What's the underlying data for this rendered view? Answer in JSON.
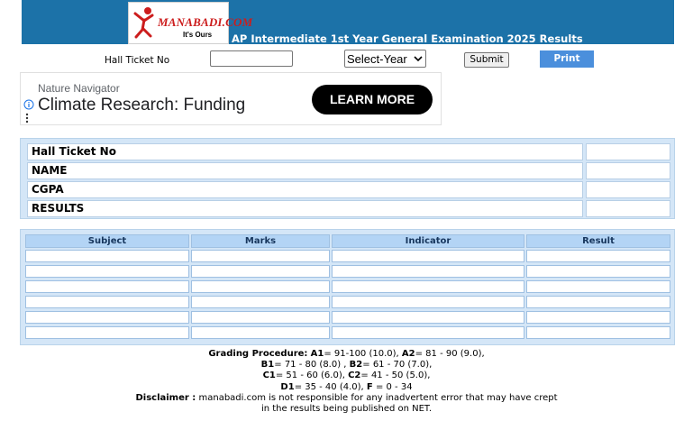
{
  "header": {
    "logo_text": "MANABADI.COM",
    "logo_tagline": "It's Ours",
    "title": "AP Intermediate 1st Year General Examination 2025 Results"
  },
  "form": {
    "hall_ticket_label": "Hall Ticket No",
    "hall_ticket_value": "",
    "year_select_value": "Select-Year",
    "submit_label": "Submit",
    "print_label": "Print"
  },
  "ad": {
    "source": "Nature Navigator",
    "headline": "Climate Research: Funding",
    "cta": "LEARN MORE"
  },
  "info": {
    "rows": [
      {
        "label": "Hall Ticket No",
        "value": ""
      },
      {
        "label": "NAME",
        "value": ""
      },
      {
        "label": "CGPA",
        "value": ""
      },
      {
        "label": "RESULTS",
        "value": ""
      }
    ]
  },
  "marks_table": {
    "headers": [
      "Subject",
      "Marks",
      "Indicator",
      "Result"
    ],
    "rows": [
      [
        "",
        "",
        "",
        ""
      ],
      [
        "",
        "",
        "",
        ""
      ],
      [
        "",
        "",
        "",
        ""
      ],
      [
        "",
        "",
        "",
        ""
      ],
      [
        "",
        "",
        "",
        ""
      ],
      [
        "",
        "",
        "",
        ""
      ]
    ]
  },
  "footer": {
    "grading_label": "Grading Procedure:",
    "a1_label": "A1",
    "a1_value": "= 91-100 (10.0),",
    "a2_label": "A2",
    "a2_value": "= 81 - 90 (9.0),",
    "b1_label": "B1",
    "b1_value": "= 71 - 80 (8.0) ,",
    "b2_label": "B2",
    "b2_value": "= 61 - 70 (7.0),",
    "c1_label": "C1",
    "c1_value": "= 51 - 60 (6.0),",
    "c2_label": "C2",
    "c2_value": "= 41 - 50 (5.0),",
    "d1_label": "D1",
    "d1_value": "= 35 - 40 (4.0),",
    "f_label": "F",
    "f_value": "= 0 - 34",
    "disclaimer_label": "Disclaimer :",
    "disclaimer_text_1": "manabadi.com is not responsible for any inadvertent error that may have crept",
    "disclaimer_text_2": "in the results being published on NET."
  },
  "colors": {
    "header_bg": "#1c72a8",
    "print_button": "#4b8fdc",
    "panel_bg": "#d4e6f7",
    "table_header_bg": "#b3d4f5"
  }
}
